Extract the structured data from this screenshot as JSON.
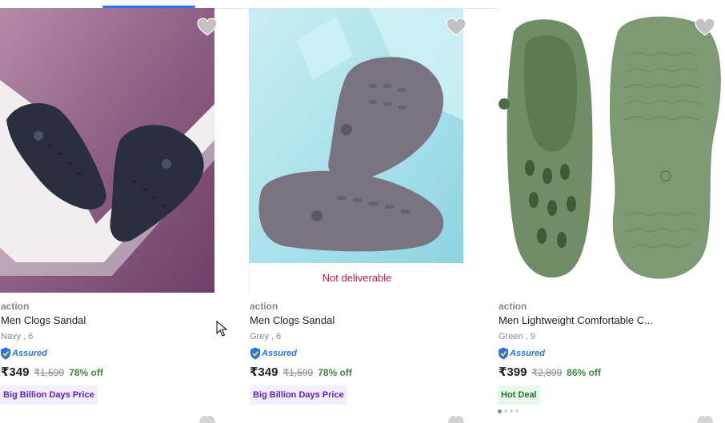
{
  "products": [
    {
      "brand": "action",
      "title": "Men Clogs Sandal",
      "variant": "Navy , 6",
      "assured": "Assured",
      "price": "₹349",
      "mrp": "₹1,599",
      "discount": "78% off",
      "tag": "Big Billion Days Price",
      "image_icon": "navy-clogs-image"
    },
    {
      "brand": "action",
      "title": "Men Clogs Sandal",
      "variant": "Grey , 6",
      "assured": "Assured",
      "price": "₹349",
      "mrp": "₹1,599",
      "discount": "78% off",
      "tag": "Big Billion Days Price",
      "overlay": "Not deliverable",
      "image_icon": "grey-clogs-image"
    },
    {
      "brand": "action",
      "title": "Men Lightweight Comfortable C...",
      "variant": "Green , 9",
      "assured": "Assured",
      "price": "₹399",
      "mrp": "₹2,899",
      "discount": "86% off",
      "tag": "Hot Deal",
      "image_icon": "green-clogs-image"
    }
  ],
  "colors": {
    "accent": "#2874f0",
    "discount": "#388e3c",
    "not_deliverable": "#c2185b",
    "bbd_tag_bg": "#f3efff",
    "bbd_tag_text": "#6a1bd1",
    "hot_tag_bg": "#e8f7e9",
    "hot_tag_text": "#1b7a2b",
    "muted": "#878787"
  },
  "icons": {
    "wishlist": "heart-icon",
    "assured": "assured-shield-icon",
    "cursor": "mouse-pointer-icon"
  }
}
